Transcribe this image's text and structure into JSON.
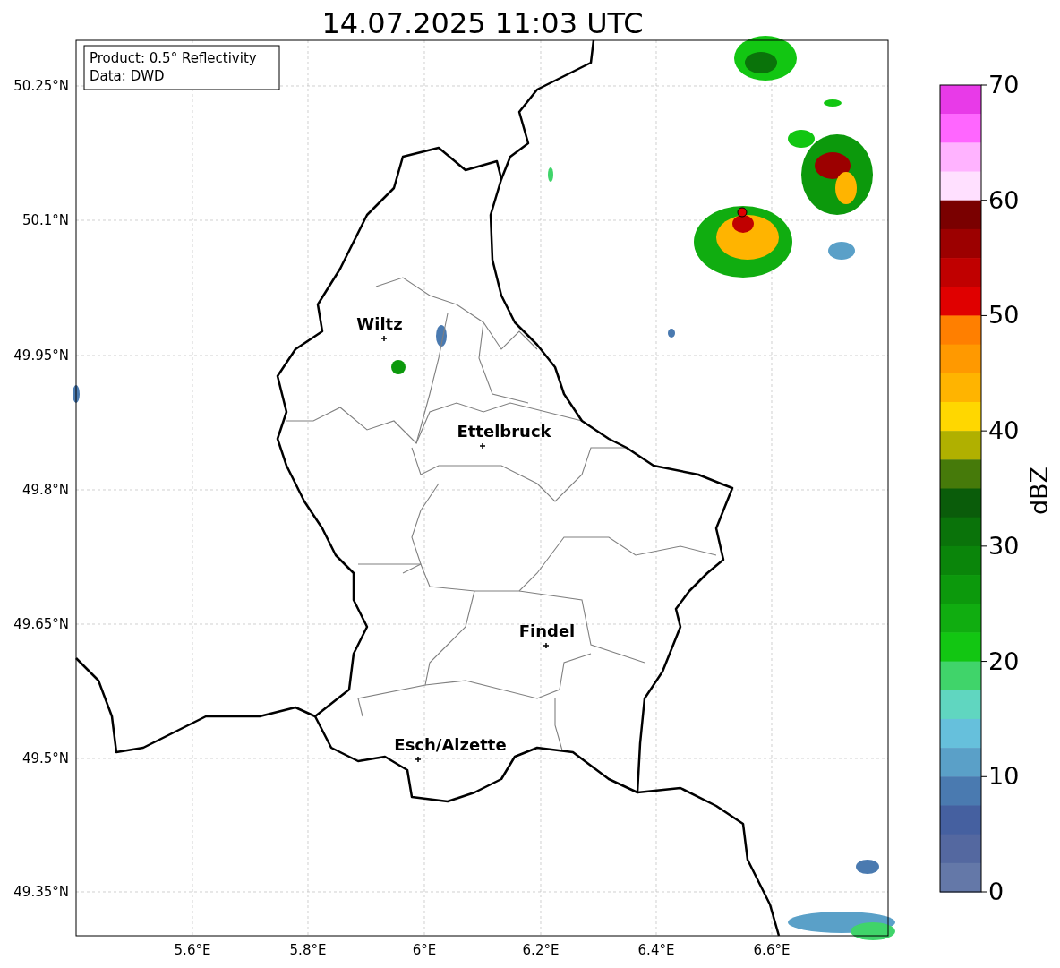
{
  "title": "14.07.2025 11:03 UTC",
  "info_box": [
    "Product: 0.5° Reflectivity",
    "Data: DWD"
  ],
  "lat_ticks": [
    "50.25°N",
    "50.1°N",
    "49.95°N",
    "49.8°N",
    "49.65°N",
    "49.5°N",
    "49.35°N"
  ],
  "lon_ticks": [
    "5.6°E",
    "5.8°E",
    "6°E",
    "6.2°E",
    "6.4°E",
    "6.6°E"
  ],
  "cities": [
    {
      "name": "Wiltz"
    },
    {
      "name": "Ettelbruck"
    },
    {
      "name": "Findel"
    },
    {
      "name": "Esch/Alzette"
    }
  ],
  "colorbar": {
    "label": "dBZ",
    "ticks": [
      "70",
      "60",
      "50",
      "40",
      "30",
      "20",
      "10",
      "0"
    ],
    "bins": [
      {
        "color": "#e83ae8"
      },
      {
        "color": "#ff66ff"
      },
      {
        "color": "#ffb3ff"
      },
      {
        "color": "#ffe0ff"
      },
      {
        "color": "#7a0000"
      },
      {
        "color": "#9c0000"
      },
      {
        "color": "#c00000"
      },
      {
        "color": "#e00000"
      },
      {
        "color": "#ff7f00"
      },
      {
        "color": "#ff9900"
      },
      {
        "color": "#ffb400"
      },
      {
        "color": "#ffd700"
      },
      {
        "color": "#b0b000"
      },
      {
        "color": "#467a0a"
      },
      {
        "color": "#0a5c0a"
      },
      {
        "color": "#0a730a"
      },
      {
        "color": "#0a850a"
      },
      {
        "color": "#0c990c"
      },
      {
        "color": "#10ad10"
      },
      {
        "color": "#12c612"
      },
      {
        "color": "#40d46a"
      },
      {
        "color": "#60d6c0"
      },
      {
        "color": "#66c0dc"
      },
      {
        "color": "#5aa0c8"
      },
      {
        "color": "#4a7ab0"
      },
      {
        "color": "#4560a0"
      },
      {
        "color": "#5468a0"
      },
      {
        "color": "#6478a8"
      }
    ]
  }
}
